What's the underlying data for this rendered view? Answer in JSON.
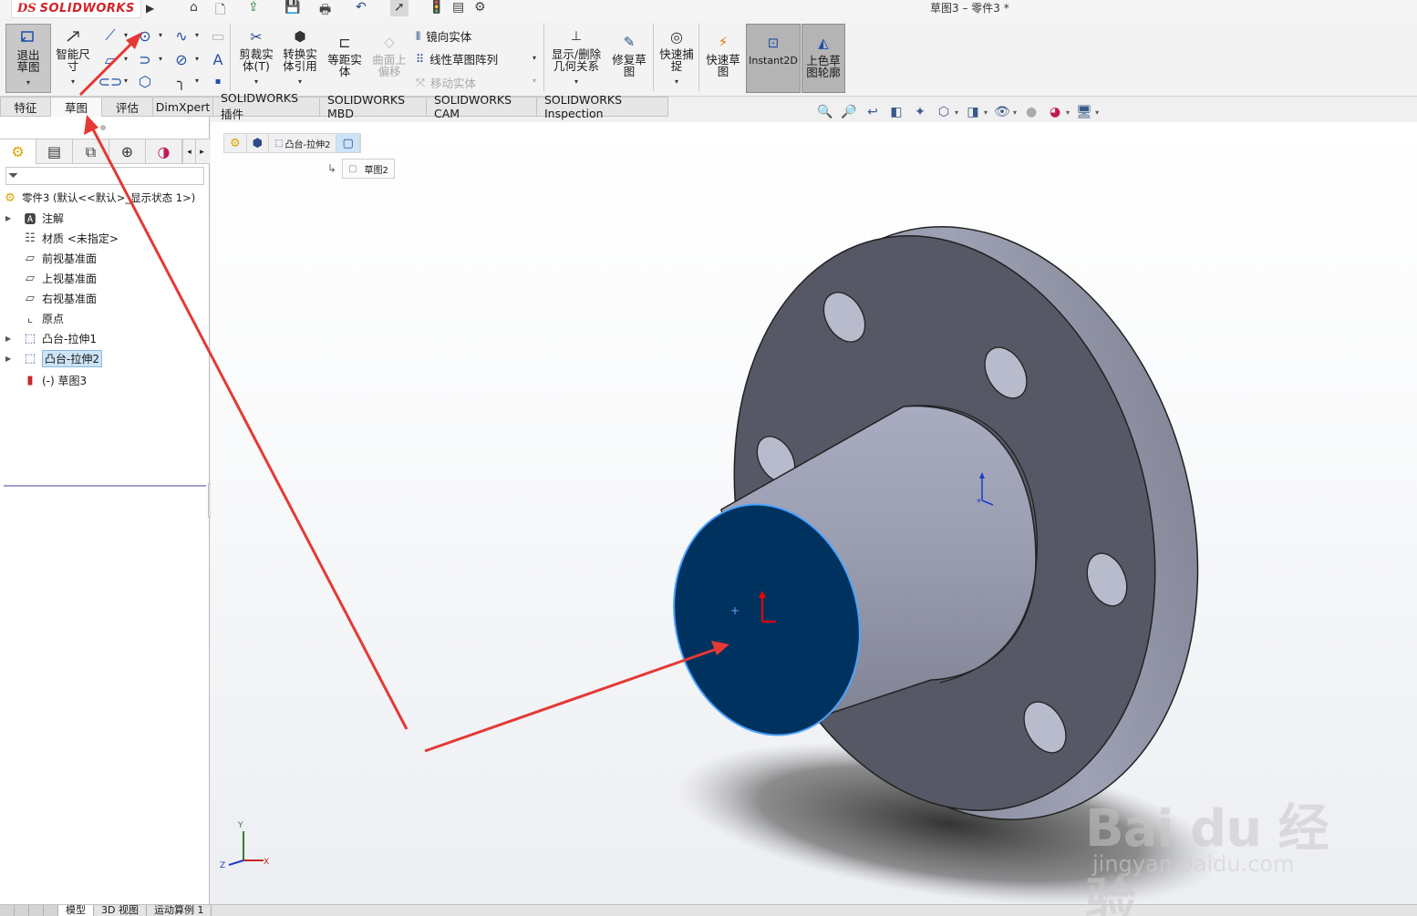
{
  "app": {
    "logo_ds": "DS",
    "logo_name": "SOLIDWORKS",
    "document_title": "草图3 – 零件3 *"
  },
  "ribbon": {
    "exit_sketch": "退出草图",
    "smart_dimension": "智能尺寸",
    "trim_entities": "剪裁实体(T)",
    "convert_entities": "转换实体引用",
    "offset_entities": "等距实体",
    "offset_on_surface": "曲面上偏移",
    "mirror_entities": "镜向实体",
    "linear_pattern": "线性草图阵列",
    "move_entities": "移动实体",
    "display_relations": "显示/删除几何关系",
    "repair_sketch": "修复草图",
    "quick_snaps": "快速捕捉",
    "rapid_sketch": "快速草图",
    "instant2d": "Instant2D",
    "shaded_contours": "上色草图轮廓"
  },
  "command_tabs": [
    {
      "label": "特征",
      "active": false
    },
    {
      "label": "草图",
      "active": true
    },
    {
      "label": "评估",
      "active": false
    },
    {
      "label": "DimXpert",
      "active": false
    },
    {
      "label": "SOLIDWORKS 插件",
      "active": false
    },
    {
      "label": "SOLIDWORKS MBD",
      "active": false
    },
    {
      "label": "SOLIDWORKS CAM",
      "active": false
    },
    {
      "label": "SOLIDWORKS Inspection",
      "active": false
    }
  ],
  "tree": {
    "root": "零件3  (默认<<默认>_显示状态 1>)",
    "items": [
      {
        "label": "注解",
        "icon": "annotation-icon",
        "expandable": true
      },
      {
        "label": "材质 <未指定>",
        "icon": "material-icon",
        "expandable": false
      },
      {
        "label": "前视基准面",
        "icon": "plane-icon",
        "expandable": false
      },
      {
        "label": "上视基准面",
        "icon": "plane-icon",
        "expandable": false
      },
      {
        "label": "右视基准面",
        "icon": "plane-icon",
        "expandable": false
      },
      {
        "label": "原点",
        "icon": "origin-icon",
        "expandable": false
      },
      {
        "label": "凸台-拉伸1",
        "icon": "extrude-icon",
        "expandable": true
      },
      {
        "label": "凸台-拉伸2",
        "icon": "extrude-icon",
        "expandable": true,
        "selected": true
      },
      {
        "label": "(-) 草图3",
        "icon": "sketch-icon",
        "expandable": false
      }
    ]
  },
  "breadcrumb": {
    "feature": "凸台-拉伸2",
    "sketch": "草图2"
  },
  "bottom_tabs": [
    "模型",
    "3D 视图",
    "运动算例 1"
  ],
  "watermark": {
    "brand": "Bai du 经验",
    "url": "jingyan.baidu.com"
  },
  "colors": {
    "accent_red": "#e53935",
    "selected_face": "#00325f",
    "selection_edge": "#4aa3ff",
    "body_gray": "#8c8fa0"
  }
}
